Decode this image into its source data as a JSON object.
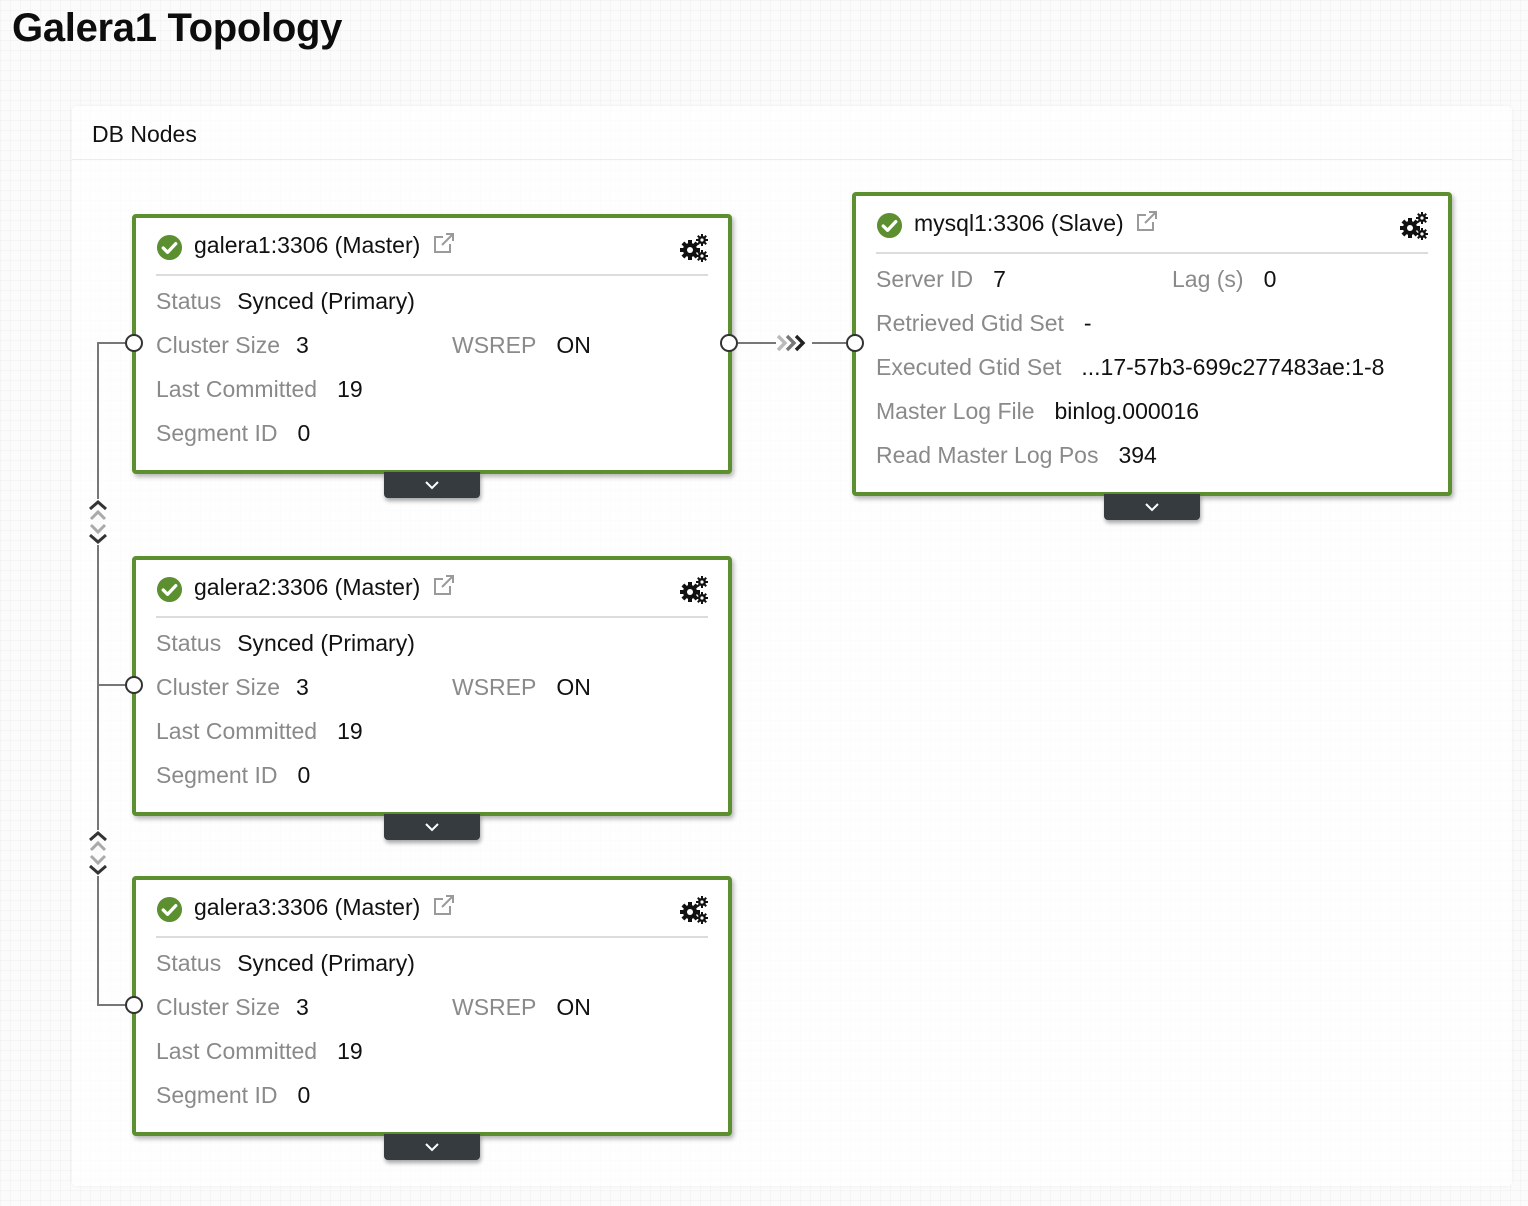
{
  "page": {
    "title": "Galera1 Topology"
  },
  "panel": {
    "title": "DB Nodes"
  },
  "colors": {
    "node_border_ok": "#5c8f2f",
    "status_ok": "#5c8f2f",
    "label": "#8a8a8a",
    "value": "#111111",
    "expand_button": "#363b40"
  },
  "icons": {
    "status": "check-circle-icon",
    "external_link": "external-link-icon",
    "settings": "gears-icon",
    "expand": "chevron-down-icon",
    "replication": "triple-chevron-right-icon",
    "galera_sync": "bidirectional-sync-icon"
  },
  "galera_nodes": [
    {
      "title": "galera1:3306 (Master)",
      "status": "ok",
      "fields": {
        "status_label": "Status",
        "status_value": "Synced (Primary)",
        "cluster_size_label": "Cluster Size",
        "cluster_size_value": "3",
        "wsrep_label": "WSREP",
        "wsrep_value": "ON",
        "last_committed_label": "Last Committed",
        "last_committed_value": "19",
        "segment_id_label": "Segment ID",
        "segment_id_value": "0"
      }
    },
    {
      "title": "galera2:3306 (Master)",
      "status": "ok",
      "fields": {
        "status_label": "Status",
        "status_value": "Synced (Primary)",
        "cluster_size_label": "Cluster Size",
        "cluster_size_value": "3",
        "wsrep_label": "WSREP",
        "wsrep_value": "ON",
        "last_committed_label": "Last Committed",
        "last_committed_value": "19",
        "segment_id_label": "Segment ID",
        "segment_id_value": "0"
      }
    },
    {
      "title": "galera3:3306 (Master)",
      "status": "ok",
      "fields": {
        "status_label": "Status",
        "status_value": "Synced (Primary)",
        "cluster_size_label": "Cluster Size",
        "cluster_size_value": "3",
        "wsrep_label": "WSREP",
        "wsrep_value": "ON",
        "last_committed_label": "Last Committed",
        "last_committed_value": "19",
        "segment_id_label": "Segment ID",
        "segment_id_value": "0"
      }
    }
  ],
  "slave_node": {
    "title": "mysql1:3306 (Slave)",
    "status": "ok",
    "fields": {
      "server_id_label": "Server ID",
      "server_id_value": "7",
      "lag_label": "Lag (s)",
      "lag_value": "0",
      "retrieved_gtid_label": "Retrieved Gtid Set",
      "retrieved_gtid_value": "-",
      "executed_gtid_label": "Executed Gtid Set",
      "executed_gtid_value": "...17-57b3-699c277483ae:1-8",
      "master_log_file_label": "Master Log File",
      "master_log_file_value": "binlog.000016",
      "read_master_log_pos_label": "Read Master Log Pos",
      "read_master_log_pos_value": "394"
    }
  }
}
